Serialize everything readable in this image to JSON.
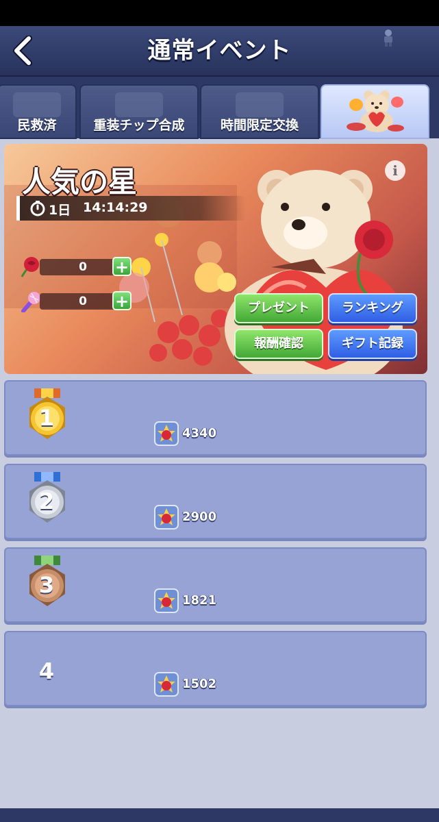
{
  "header": {
    "title": "通常イベント"
  },
  "tabs": [
    {
      "label": "民救済",
      "active": false
    },
    {
      "label": "重装チップ合成",
      "active": false
    },
    {
      "label": "時間限定交換",
      "active": false
    },
    {
      "label": "",
      "active": true,
      "icon": "teddy-bear-icon"
    }
  ],
  "event": {
    "name": "人気の星",
    "timer_days": "1日",
    "timer_time": "14:14:29",
    "resources": [
      {
        "icon": "rose-icon",
        "value": "0"
      },
      {
        "icon": "microphone-icon",
        "value": "0"
      }
    ],
    "buttons": {
      "present": "プレゼント",
      "ranking": "ランキング",
      "rewards": "報酬確認",
      "gift_log": "ギフト記録"
    }
  },
  "ranking": [
    {
      "rank": "1",
      "medal": "gold",
      "score": "4340"
    },
    {
      "rank": "2",
      "medal": "silver",
      "score": "2900"
    },
    {
      "rank": "3",
      "medal": "bronze",
      "score": "1821"
    },
    {
      "rank": "4",
      "medal": "none",
      "score": "1502"
    }
  ],
  "colors": {
    "header_bg": "#27335c",
    "panel_bg": "#c9cde0",
    "row_bg": "#97a3d4",
    "green_button": "#43a836",
    "blue_button": "#2f5ee4"
  }
}
